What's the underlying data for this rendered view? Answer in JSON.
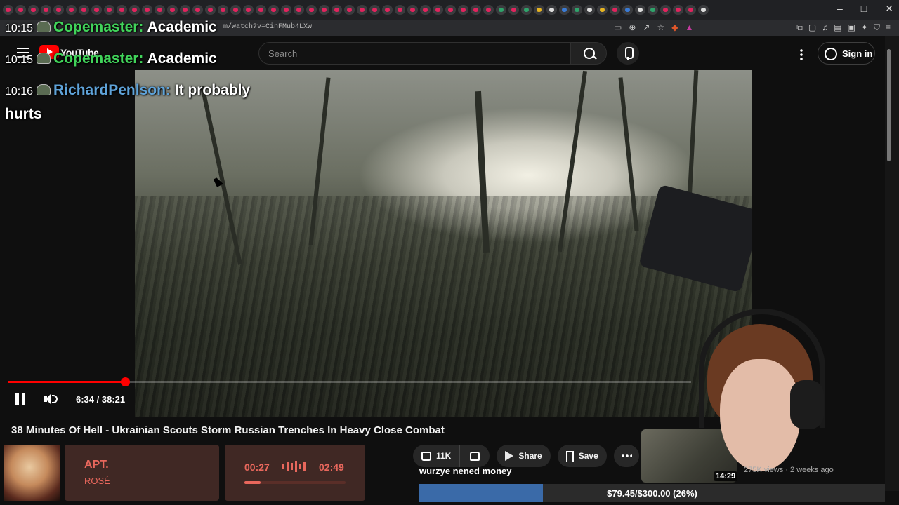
{
  "browser": {
    "url": "m/watch?v=CinFMub4LXw",
    "window_controls": [
      "–",
      "□",
      "✕"
    ]
  },
  "header": {
    "logo_text": "YouTube",
    "search_placeholder": "Search",
    "signin_label": "Sign in"
  },
  "player": {
    "time_display": "6:34 / 38:21",
    "progress_fraction": 0.171,
    "title": "38 Minutes Of Hell - Ukrainian Scouts Storm Russian Trenches In Heavy Close Combat"
  },
  "chat": [
    {
      "time": "10:15",
      "user": "Copemaster:",
      "message": "Academic"
    },
    {
      "time": "10:15",
      "user": "Copemaster:",
      "message": "Academic"
    },
    {
      "time": "10:16",
      "user": "RichardPenlson:",
      "message": "It probably"
    },
    {
      "time": "",
      "user": "",
      "message": "hurts"
    }
  ],
  "actions": {
    "like_count": "11K",
    "share_label": "Share",
    "save_label": "Save"
  },
  "now_playing": {
    "title": "APT.",
    "artist": "ROSÉ",
    "elapsed": "00:27",
    "total": "02:49",
    "progress_fraction": 0.16
  },
  "donation": {
    "message": "wurzye nened money",
    "label": "$79.45/$300.00 (26%)",
    "progress_fraction": 0.265
  },
  "recommended": {
    "duration": "14:29",
    "meta": "275K views · 2 weeks ago"
  },
  "colors": {
    "youtube_red": "#ff0000",
    "chat_green": "#41d35a",
    "chat_blue": "#5fa3d9",
    "song_card_bg": "#402824",
    "song_accent": "#e8675c",
    "donation_fill": "#3a6aa8"
  }
}
